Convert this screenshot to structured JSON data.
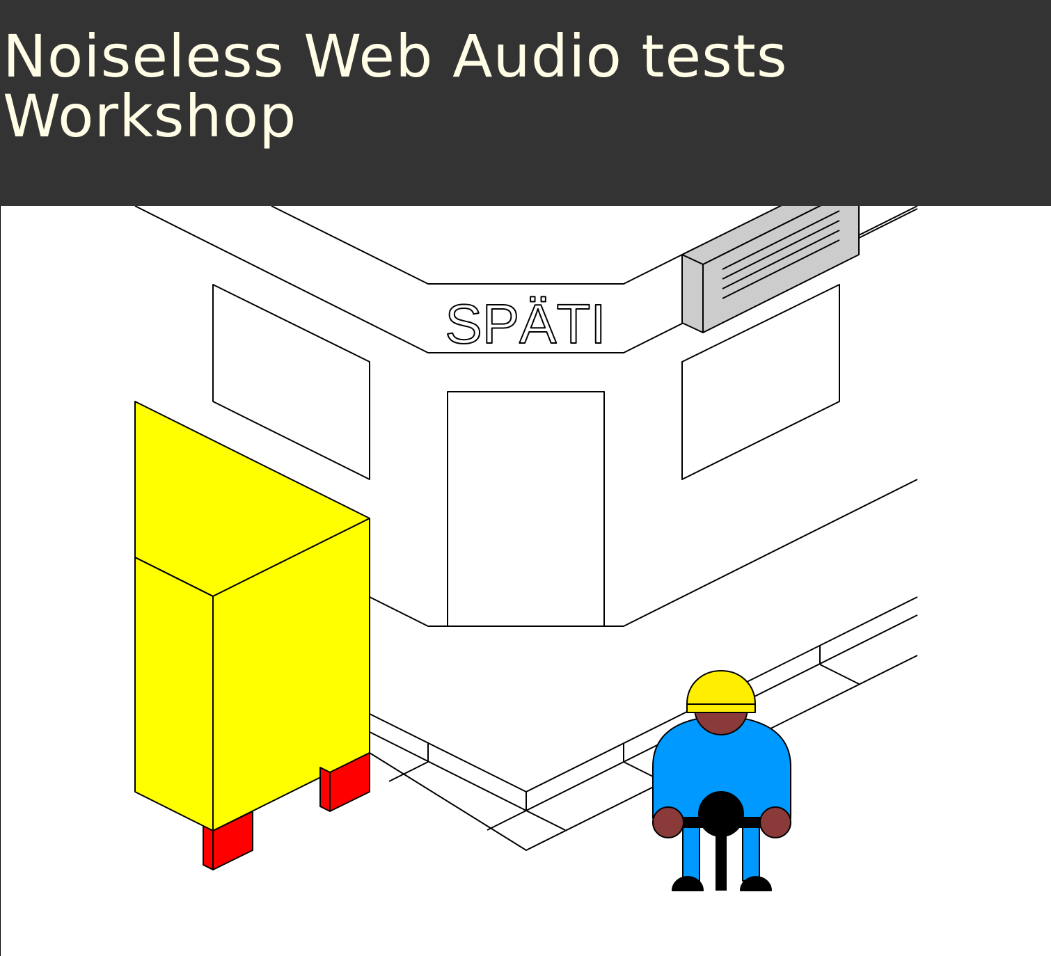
{
  "header": {
    "title_line1": "Noiseless Web Audio tests",
    "title_line2": "Workshop",
    "background_color": "#333333",
    "text_color": "#fffde6"
  },
  "illustration": {
    "shop_sign": "SPÄTI",
    "colors": {
      "box_yellow": "#ffff00",
      "box_legs_red": "#ff0000",
      "ac_unit_gray": "#cccccc",
      "helmet_yellow": "#ffee00",
      "worker_blue": "#0099ff",
      "worker_skin": "#8b3a3a",
      "outline": "#000000"
    }
  }
}
